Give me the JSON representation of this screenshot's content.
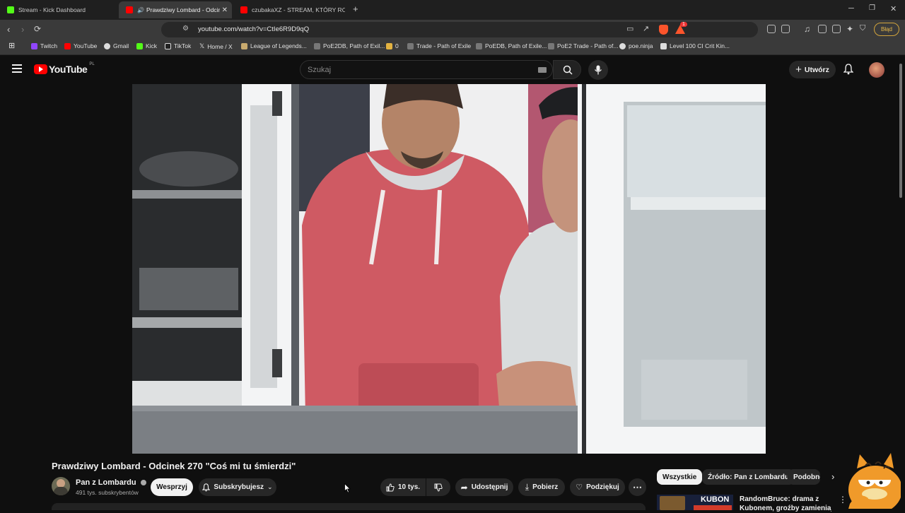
{
  "tabs": [
    {
      "title": "Stream - Kick Dashboard",
      "favicon_color": "#53fc18"
    },
    {
      "title": "Prawdziwy Lombard - Odcine",
      "favicon_color": "#ff0000"
    },
    {
      "title": "czubakaXZ - STREAM, KTÓRY ROZWA",
      "favicon_color": "#ff0000"
    }
  ],
  "browser": {
    "url": "youtube.com/watch?v=CtIe6R9D9qQ",
    "error_badge": "Błąd",
    "new_tab": "+",
    "extension_count": "1"
  },
  "bookmarks": [
    {
      "label": "Twitch",
      "color": "#9146ff"
    },
    {
      "label": "YouTube",
      "color": "#ff0000"
    },
    {
      "label": "Gmail",
      "color": "#dddddd"
    },
    {
      "label": "Kick",
      "color": "#53fc18"
    },
    {
      "label": "TikTok",
      "color": "#dddddd"
    },
    {
      "label": "Home / X",
      "color": "#dddddd"
    },
    {
      "label": "League of Legends...",
      "color": "#c8aa6e"
    },
    {
      "label": "PoE2DB, Path of Exil...",
      "color": "#888888"
    },
    {
      "label": "0",
      "color": "#e3b341"
    },
    {
      "label": "Trade - Path of Exile",
      "color": "#888888"
    },
    {
      "label": "PoEDB, Path of Exile...",
      "color": "#888888"
    },
    {
      "label": "PoE2 Trade - Path of...",
      "color": "#888888"
    },
    {
      "label": "poe.ninja",
      "color": "#dddddd"
    },
    {
      "label": "Level 100 CI Crit Kin...",
      "color": "#dddddd"
    }
  ],
  "youtube": {
    "logo_text": "YouTube",
    "region": "PL",
    "search_placeholder": "Szukaj",
    "create_label": "Utwórz",
    "brand_color": "#ff0000"
  },
  "video": {
    "title": "Prawdziwy Lombard - Odcinek 270 \"Coś mi tu śmierdzi\"",
    "channel": "Pan z Lombardu",
    "subscribers": "491 tys. subskrybentów",
    "support_label": "Wesprzyj",
    "subscribed_label": "Subskrybujesz",
    "likes": "10 tys.",
    "share_label": "Udostępnij",
    "download_label": "Pobierz",
    "thanks_label": "Podziękuj"
  },
  "chips": [
    "Wszystkie",
    "Źródło: Pan z Lombardu",
    "Podobne"
  ],
  "recommended": {
    "thumb_text_top": "KUBON",
    "title_line1": "RandomBruce: drama z",
    "title_line2": "Kubonem, groźby zamieniają s"
  }
}
